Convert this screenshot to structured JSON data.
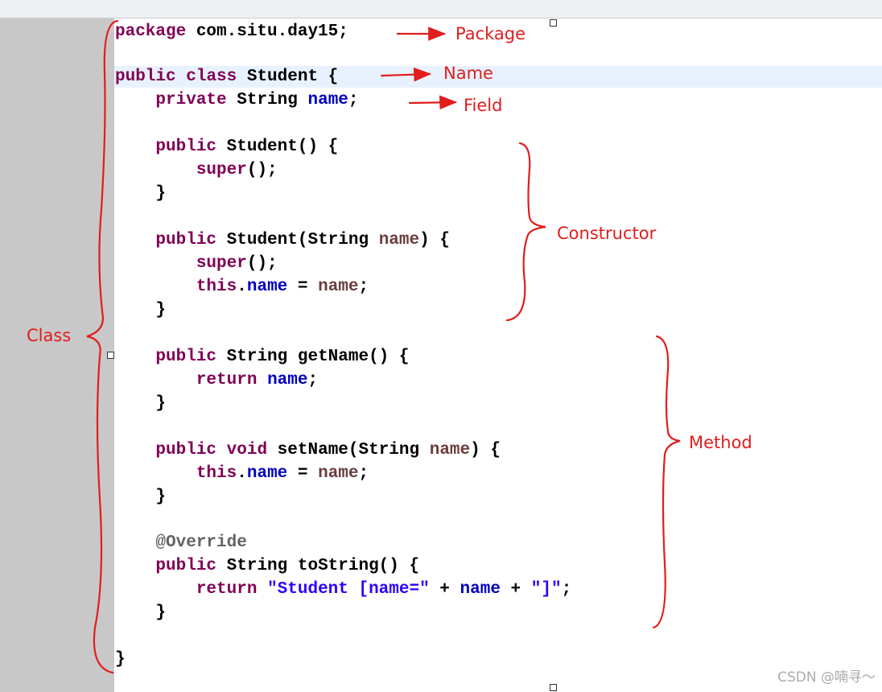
{
  "code": {
    "package_kw": "package",
    "package_name": " com.situ.day15;",
    "public": "public",
    "class_kw": "class",
    "private": "private",
    "void_kw": "void",
    "super_kw": "super",
    "this_kw": "this",
    "return_kw": "return",
    "type_string": "String",
    "class_name": "Student",
    "field_name": "name",
    "getter": "getName",
    "setter": "setName",
    "tostring": "toString",
    "annotation": "@Override",
    "str_open": "\"Student [name=\"",
    "str_close": "\"]\"",
    "l1": " Student {",
    "l2a": "    ",
    "l2b": ";",
    "l3": " Student() {",
    "l4": "();",
    "l5": "}",
    "l6": " Student(String ",
    "l6end": ") {",
    "l8mid": " = ",
    "l10": " String getName() {",
    "l13": " setName(String ",
    "l17": " String toString() {",
    "l18mid": " + ",
    "closing_brace": "}"
  },
  "annotations": {
    "package": "Package",
    "name": "Name",
    "field": "Field",
    "constructor": "Constructor",
    "method": "Method",
    "class": "Class"
  },
  "colors": {
    "keyword": "#7f0055",
    "field": "#0000c0",
    "param": "#6a3e3e",
    "string": "#2a00ff",
    "annotation_gray": "#646464",
    "markup_red": "#e11d1d",
    "gutter": "#c8c8c8",
    "line_highlight": "#e8f2fe"
  },
  "watermark": "CSDN @喃寻～"
}
